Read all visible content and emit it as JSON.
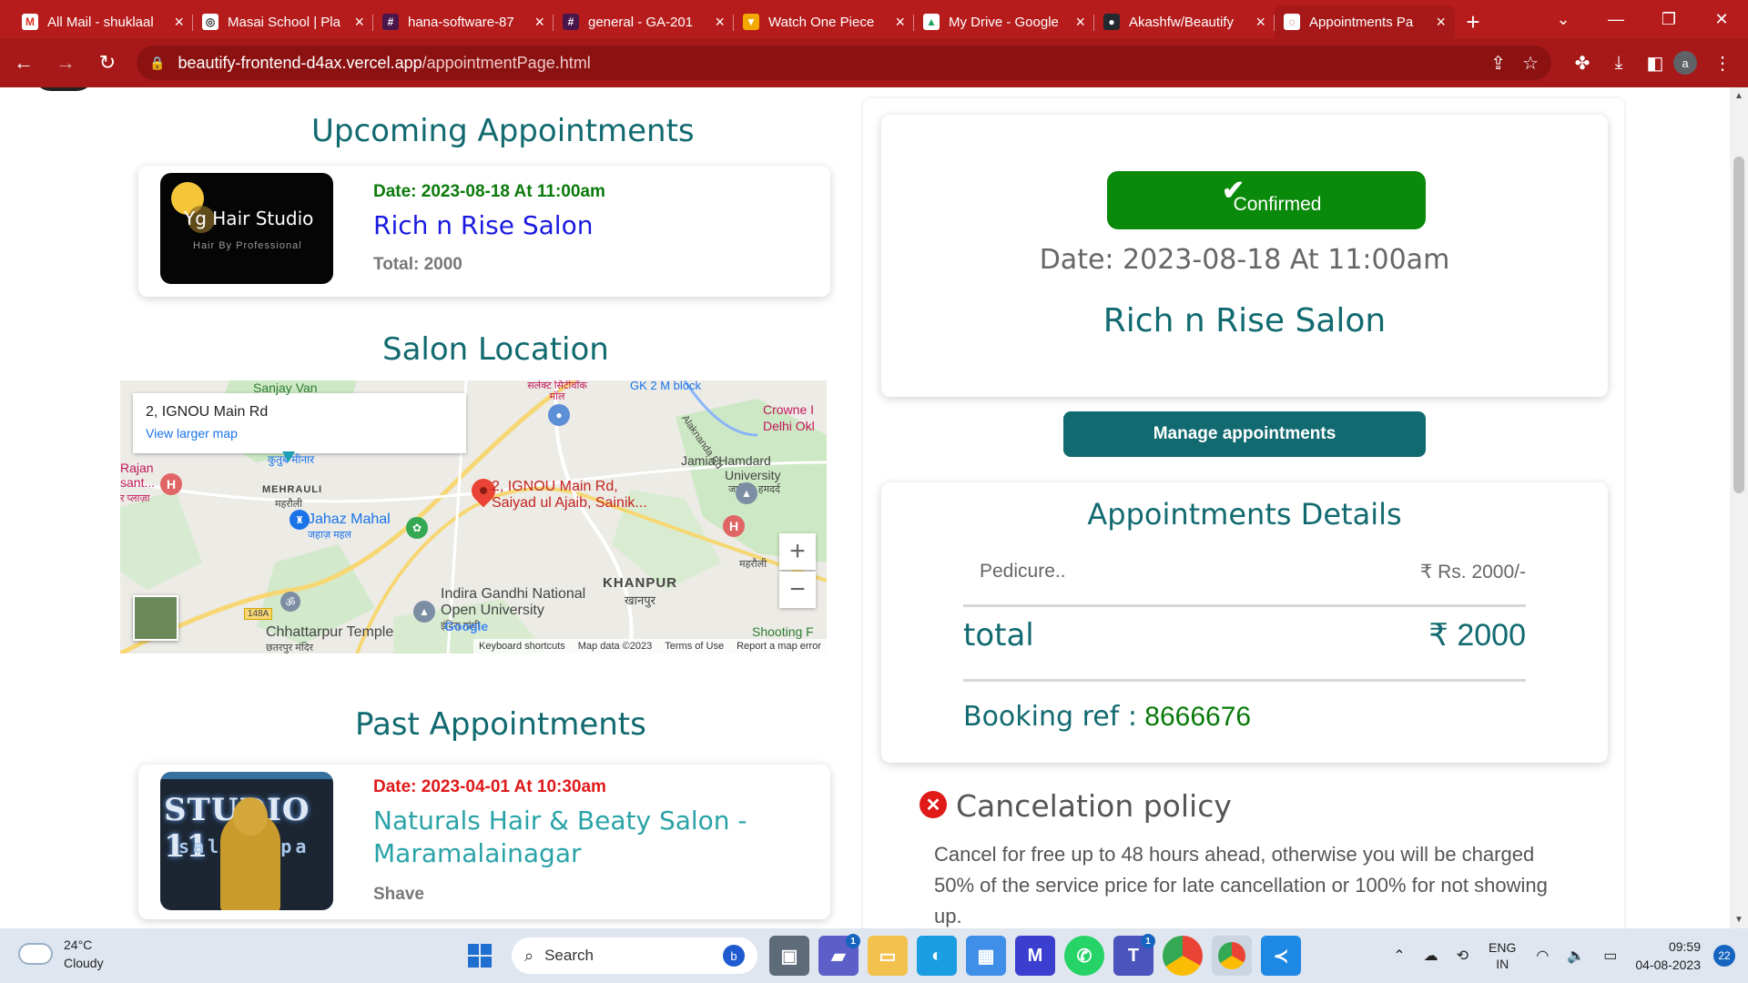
{
  "browser": {
    "tabs": [
      {
        "title": "All Mail - shuklaal",
        "fav_color": "#ffffff",
        "fav_glyph": "M",
        "fav_text_color": "#d93025"
      },
      {
        "title": "Masai School | Pla",
        "fav_color": "#ffffff",
        "fav_glyph": "◎",
        "fav_text_color": "#333333"
      },
      {
        "title": "hana-software-87",
        "fav_color": "#4a154b",
        "fav_glyph": "#",
        "fav_text_color": "#ffffff"
      },
      {
        "title": "general - GA-201",
        "fav_color": "#4a154b",
        "fav_glyph": "#",
        "fav_text_color": "#ffffff"
      },
      {
        "title": "Watch One Piece",
        "fav_color": "#f2a900",
        "fav_glyph": "▼",
        "fav_text_color": "#ffffff"
      },
      {
        "title": "My Drive - Google",
        "fav_color": "#ffffff",
        "fav_glyph": "▲",
        "fav_text_color": "#1fa463"
      },
      {
        "title": "Akashfw/Beautify",
        "fav_color": "#24292f",
        "fav_glyph": "●",
        "fav_text_color": "#ffffff"
      },
      {
        "title": "Appointments Pa",
        "fav_color": "#ffffff",
        "fav_glyph": "◌",
        "fav_text_color": "#b71c1c"
      }
    ],
    "url_domain": "beautify-frontend-d4ax.vercel.app",
    "url_path": "/appointmentPage.html",
    "profile_initial": "a"
  },
  "page": {
    "upcoming_title": "Upcoming Appointments",
    "upcoming": {
      "thumb_title": "Yg Hair Studio",
      "thumb_sub": "Hair By Professional",
      "date": "Date: 2023-08-18 At 11:00am",
      "salon": "Rich n Rise Salon",
      "total": "Total: 2000"
    },
    "location_title": "Salon Location",
    "map": {
      "info_address": "2, IGNOU Main Rd",
      "info_link": "View larger map",
      "pin_label_1": "2, IGNOU Main Rd,",
      "pin_label_2": "Saiyad ul Ajaib, Sainik...",
      "labels": {
        "sanjay_van": "Sanjay Van",
        "select_city": "सलेक्ट सिटीवॉक मॉल",
        "crowne": "Crowne I",
        "delhi_ok": "Delhi Okl",
        "alaknanda": "Alaknanda Rd",
        "jamia_1": "Jamia Hamdard",
        "jamia_2": "University",
        "jamia_3": "जामिया हमदर्द",
        "qutub": "कुतुब मीनार",
        "rajan": "Rajan",
        "sant": "sant...",
        "plaza": "र प्लाज़ा",
        "mehrauli": "MEHRAULI",
        "mehrauli_hi": "महरौली",
        "jahaz": "Jahaz Mahal",
        "jahaz_hi": "जहाज़ महल",
        "mehrauli2": "महरौली",
        "ignou_1": "Indira Gandhi National",
        "ignou_2": "Open University",
        "ignou_3": "इंदिरा गांधी",
        "khanpur": "KHANPUR",
        "khanpur_hi": "खानपुर",
        "shooting": "Shooting F",
        "chhattarpur": "Chhattarpur Temple",
        "chhattarpur_hi": "छतरपुर मंदिर",
        "road": "148A",
        "gk": "GK 2 M block",
        "google": "Google"
      },
      "zoom_in": "+",
      "zoom_out": "−",
      "attrib_shortcuts": "Keyboard shortcuts",
      "attrib_data": "Map data ©2023",
      "attrib_terms": "Terms of Use",
      "attrib_report": "Report a map error"
    },
    "past_title": "Past Appointments",
    "past": {
      "thumb_line1": "STUDIO 11",
      "thumb_line2": "salon spa",
      "date": "Date: 2023-04-01 At 10:30am",
      "salon": "Naturals Hair & Beaty Salon - Maramalainagar",
      "service": "Shave"
    },
    "summary": {
      "status": "Confirmed",
      "date": "Date: 2023-08-18 At 11:00am",
      "salon": "Rich n Rise Salon"
    },
    "manage_button": "Manage appointments",
    "details": {
      "title": "Appointments Details",
      "item_name": "Pedicure..",
      "item_price": "₹ Rs. 2000/-",
      "total_label": "total",
      "total_value": "₹ 2000",
      "booking_label": "Booking ref :",
      "booking_value": "8666676"
    },
    "cancel": {
      "title": "Cancelation policy",
      "text": "Cancel for free up to 48 hours ahead, otherwise you will be charged 50% of the service price for late cancellation or 100% for not showing up."
    }
  },
  "taskbar": {
    "temp": "24°C",
    "weather": "Cloudy",
    "search": "Search",
    "lang_1": "ENG",
    "lang_2": "IN",
    "time": "09:59",
    "date": "04-08-2023",
    "notifications": "22",
    "badge_teams": "1",
    "badge_t": "1"
  },
  "colors": {
    "brand_teal": "#116a70",
    "chrome_red": "#b71c1c",
    "upcoming_date": "#0a7a0a",
    "past_date": "#e01919",
    "upcoming_salon": "#1a1ae0",
    "past_salon": "#2aa3a8",
    "confirmed": "#0a8a0a",
    "booking_value": "#0a7a0a"
  }
}
